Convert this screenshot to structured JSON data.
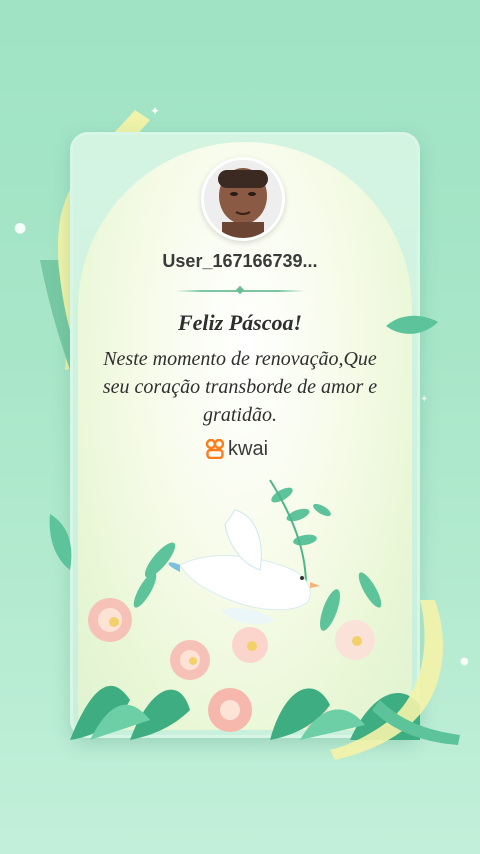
{
  "profile": {
    "username": "User_167166739..."
  },
  "card": {
    "title": "Feliz Páscoa!",
    "message_lines": [
      "Neste momento de renovação,Que",
      "seu coração transborde de amor e",
      "gratidão."
    ],
    "brand": "kwai"
  },
  "colors": {
    "background": "#a8e6c8",
    "accent_green": "#6dbd97",
    "brand_orange": "#ff7a1a"
  },
  "icons": [
    "avatar-photo",
    "kwai-logo-icon",
    "dove-illustration",
    "flowers-illustration",
    "sparkle-icon"
  ]
}
